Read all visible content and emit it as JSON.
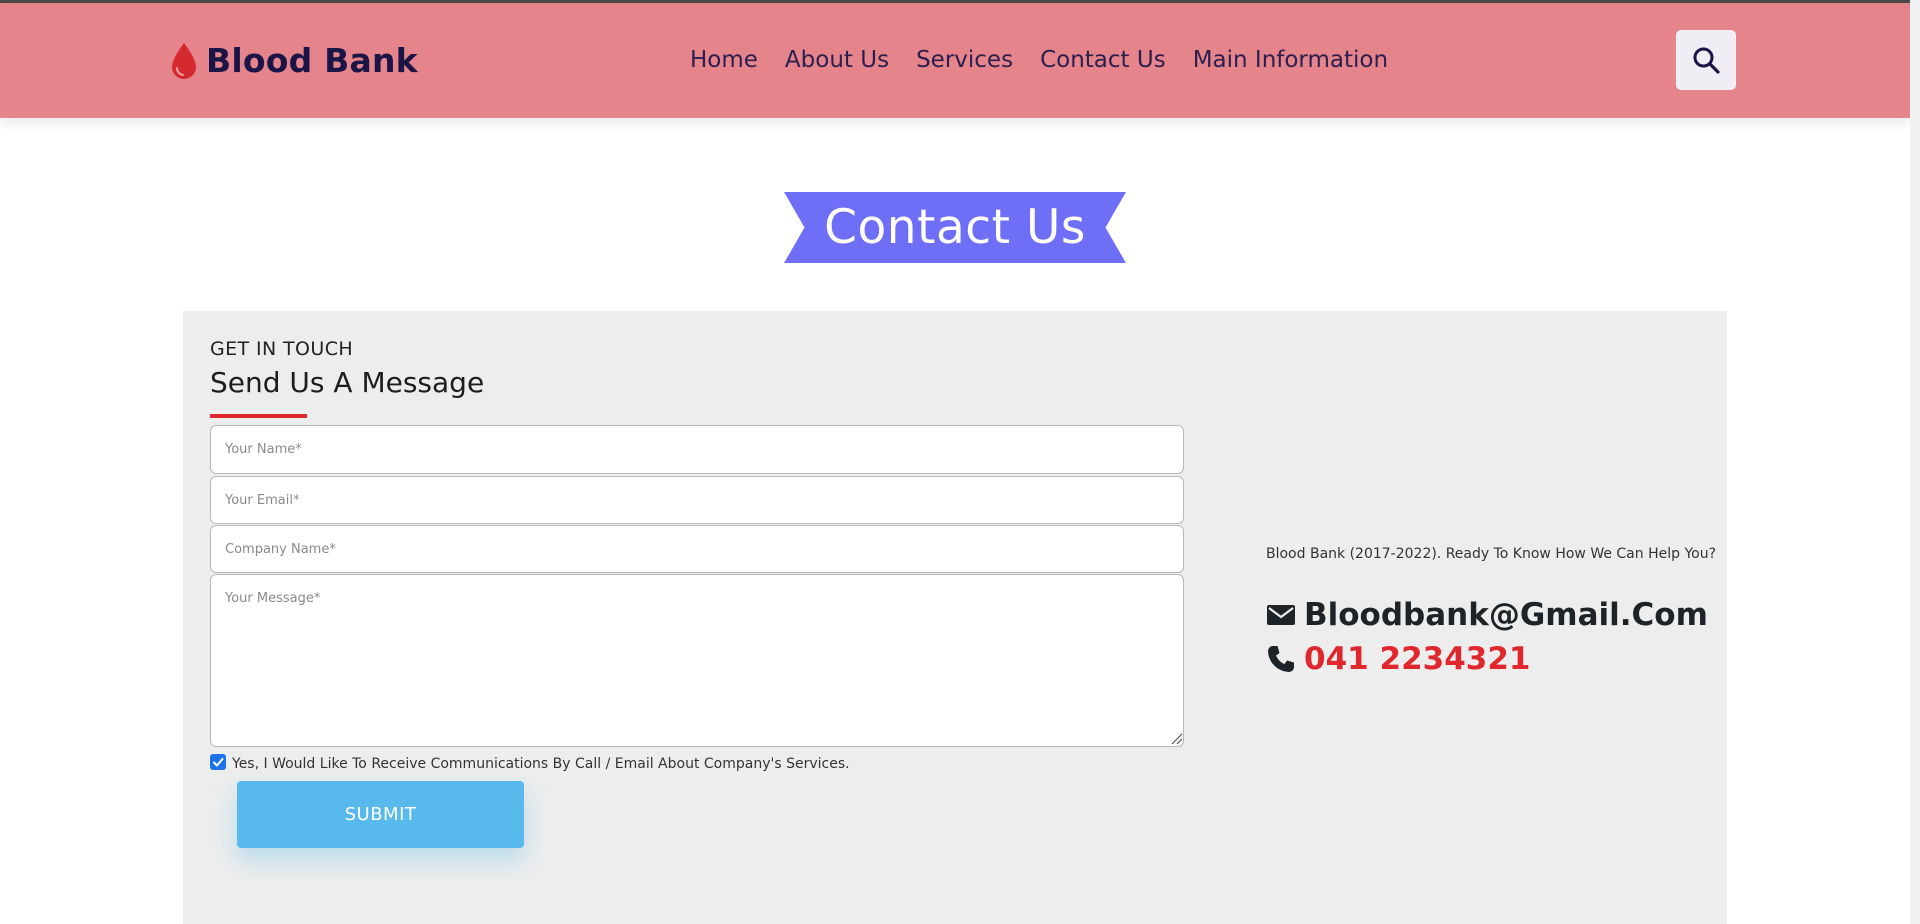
{
  "header": {
    "logo_icon": "blood-drop-icon",
    "logo_text": "Blood Bank",
    "nav": [
      {
        "label": "Home"
      },
      {
        "label": "About Us"
      },
      {
        "label": "Services"
      },
      {
        "label": "Contact Us"
      },
      {
        "label": "Main Information"
      }
    ],
    "search_icon": "search-icon",
    "background_color": "#e5848a",
    "text_color": "#1b1446"
  },
  "banner": {
    "title": "Contact Us",
    "color": "#6f6ef7"
  },
  "form": {
    "eyebrow": "GET IN TOUCH",
    "title": "Send Us A Message",
    "accent_color": "#e0272e",
    "fields": {
      "name": {
        "placeholder": "Your Name*",
        "value": ""
      },
      "email": {
        "placeholder": "Your Email*",
        "value": ""
      },
      "company": {
        "placeholder": "Company Name*",
        "value": ""
      },
      "message": {
        "placeholder": "Your Message*",
        "value": ""
      }
    },
    "consent": {
      "checked": true,
      "label": "Yes, I Would Like To Receive Communications By Call / Email About Company's Services."
    },
    "submit_label": "SUBMIT",
    "submit_color": "#57b9ec"
  },
  "contact_info": {
    "note": "Blood Bank (2017-2022). Ready To Know How We Can Help You?",
    "email_icon": "envelope-icon",
    "email": "Bloodbank@Gmail.Com",
    "phone_icon": "phone-icon",
    "phone": "041 2234321"
  }
}
